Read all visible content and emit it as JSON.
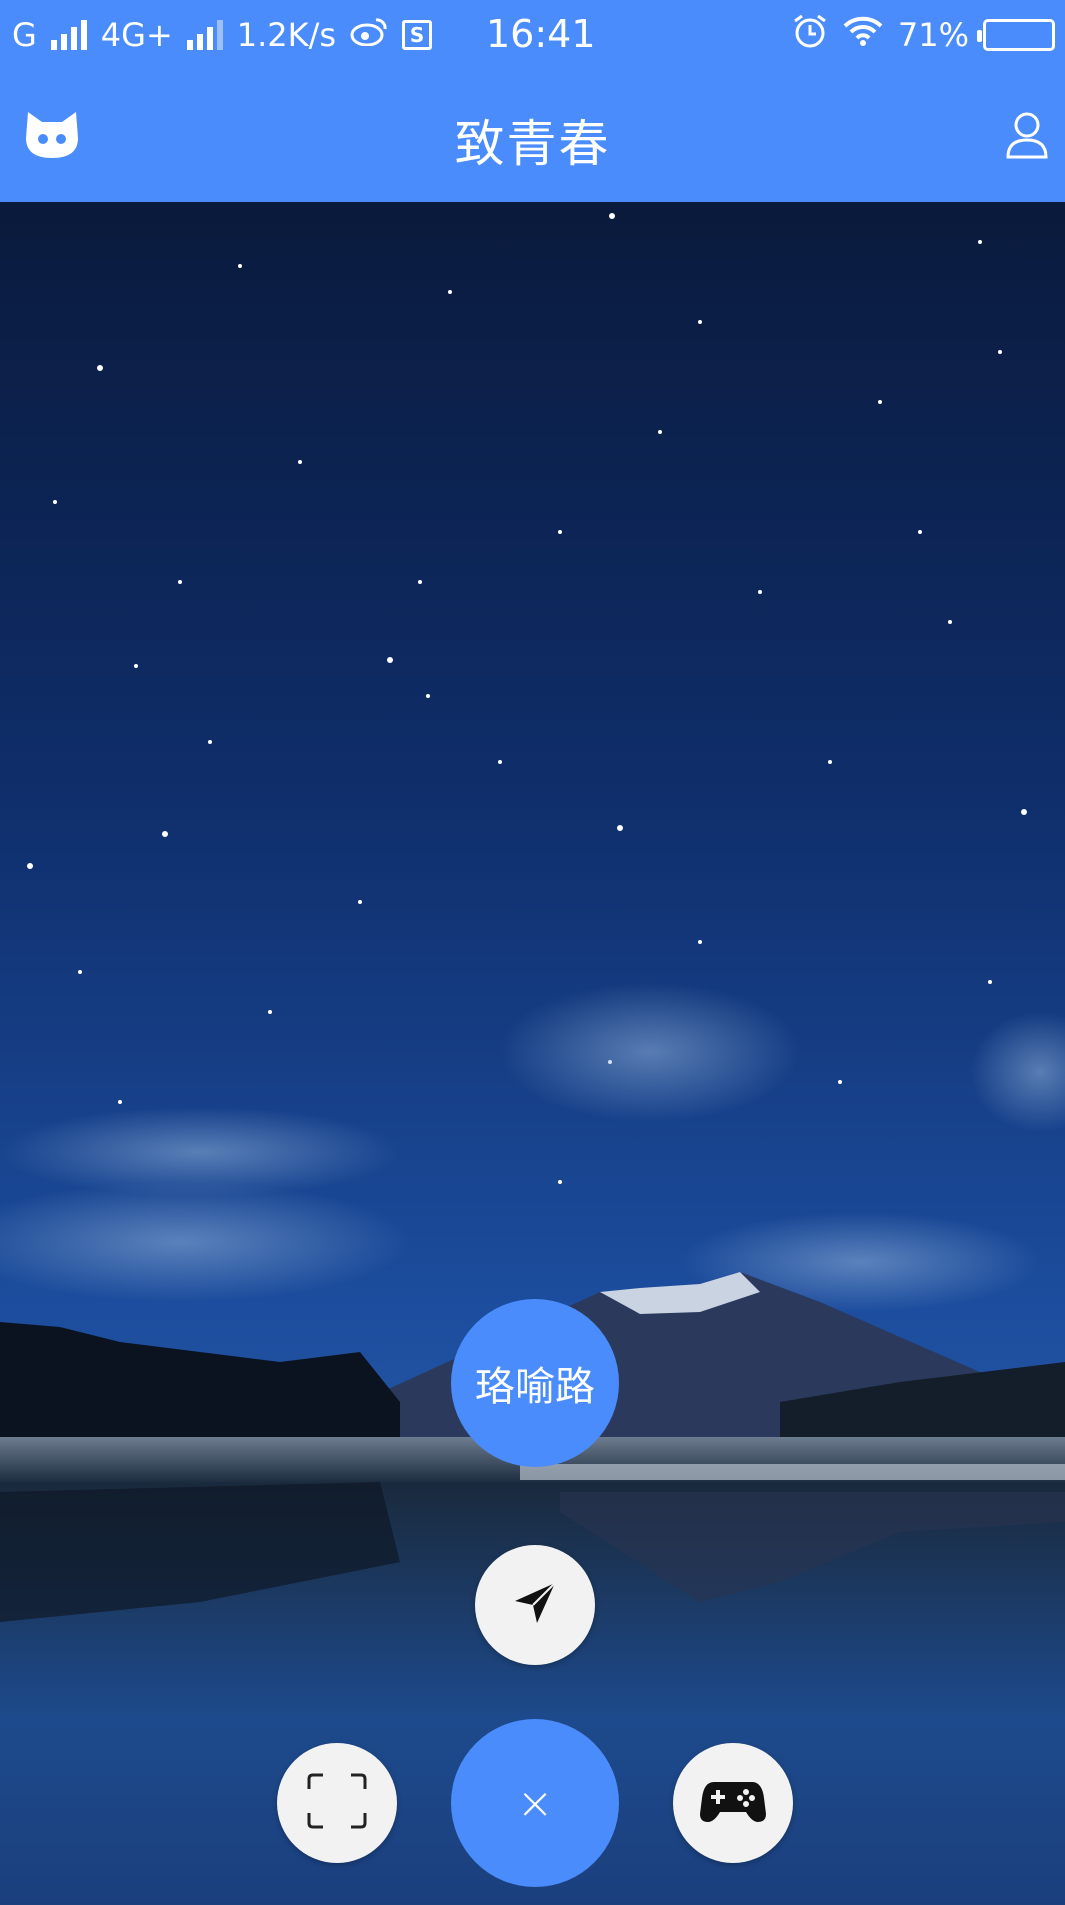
{
  "status_bar": {
    "carrier_1": "G",
    "carrier_2": "4G+",
    "net_speed": "1.2K/s",
    "time": "16:41",
    "battery": "71%",
    "icons": [
      "signal-icon",
      "weibo-icon",
      "s-app-icon",
      "alarm-icon",
      "wifi-icon",
      "battery-icon"
    ]
  },
  "app_bar": {
    "title": "致青春",
    "left_icon": "cat-logo-icon",
    "right_icon": "profile-icon"
  },
  "fab_menu": {
    "name_label": "珞喻路",
    "close_label": "×",
    "icons": [
      "send-icon",
      "scan-icon",
      "close-icon",
      "gamepad-icon"
    ],
    "accent_color": "#4a8cfb"
  }
}
